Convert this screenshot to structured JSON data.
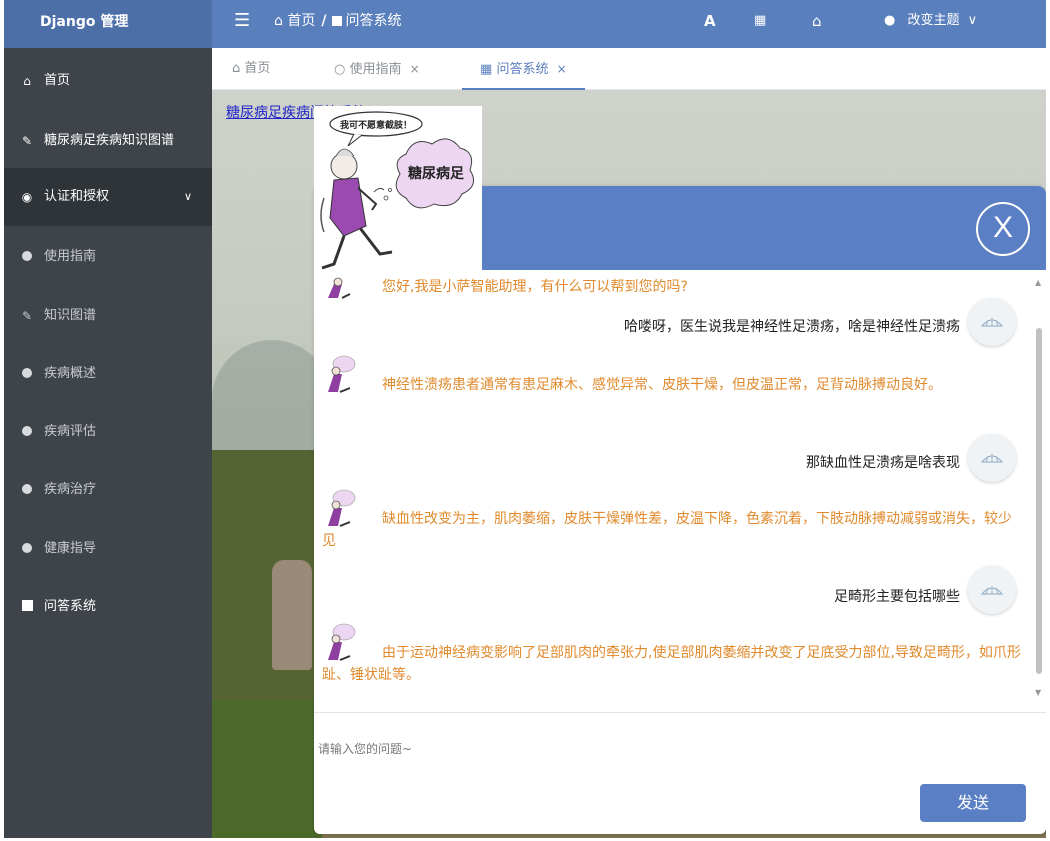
{
  "header": {
    "brand": "Django 管理",
    "menu_icon": "☰",
    "breadcrumb_home": "首页",
    "breadcrumb_sep": "/",
    "breadcrumb_current": "问答系统",
    "font_icon": "A",
    "theme_label": "改变主题"
  },
  "sidebar": {
    "items": [
      {
        "label": "首页",
        "icon": "home-icon"
      },
      {
        "label": "糖尿病足疾病知识图谱",
        "icon": "pencil-icon"
      },
      {
        "label": "认证和授权",
        "icon": "shield-icon"
      },
      {
        "label": "使用指南",
        "icon": "circle-icon"
      },
      {
        "label": "知识图谱",
        "icon": "pencil-icon"
      },
      {
        "label": "疾病概述",
        "icon": "circle-icon"
      },
      {
        "label": "疾病评估",
        "icon": "circle-icon"
      },
      {
        "label": "疾病治疗",
        "icon": "circle-icon"
      },
      {
        "label": "健康指导",
        "icon": "circle-icon"
      },
      {
        "label": "问答系统",
        "icon": "square-icon"
      }
    ]
  },
  "tabs": [
    {
      "label": "首页"
    },
    {
      "label": "使用指南",
      "close": "×"
    },
    {
      "label": "问答系统",
      "close": "×"
    }
  ],
  "content": {
    "link": "糖尿病足疾病问答系统"
  },
  "comic": {
    "bubble": "我可不愿意截肢！",
    "cloud": "糖尿病足"
  },
  "chat": {
    "close": "X",
    "messages": [
      {
        "role": "bot",
        "text": "您好,我是小萨智能助理，有什么可以帮到您的吗?"
      },
      {
        "role": "user",
        "text": "哈喽呀，医生说我是神经性足溃疡，啥是神经性足溃疡"
      },
      {
        "role": "bot",
        "text": "神经性溃疡患者通常有患足麻木、感觉异常、皮肤干燥，但皮温正常，足背动脉搏动良好。"
      },
      {
        "role": "user",
        "text": "那缺血性足溃疡是啥表现"
      },
      {
        "role": "bot",
        "text": "缺血性改变为主，肌肉萎缩，皮肤干燥弹性差，皮温下降，色素沉着，下肢动脉搏动减弱或消失，较少见"
      },
      {
        "role": "user",
        "text": "足畸形主要包括哪些"
      },
      {
        "role": "bot",
        "text": "由于运动神经病变影响了足部肌肉的牵张力,使足部肌肉萎缩并改变了足底受力部位,导致足畸形，如爪形趾、锤状趾等。"
      }
    ],
    "input_placeholder": "请输入您的问题~",
    "send_label": "发送"
  },
  "colors": {
    "header": "#5a7fbd",
    "sidebar": "#3e4449",
    "bot_text": "#e08a2c",
    "chat_head": "#5a7fc4"
  }
}
